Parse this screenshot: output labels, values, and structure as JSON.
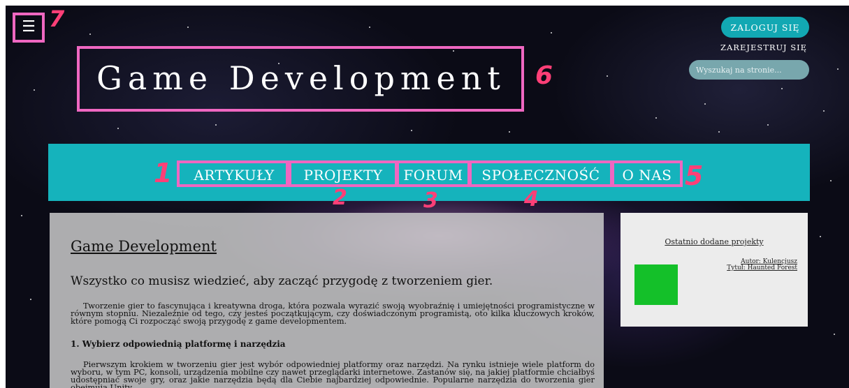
{
  "header": {
    "menu_icon": "hamburger-icon",
    "menu_glyph": "☰",
    "site_title": "Game Development",
    "login_label": "ZALOGUJ SIĘ",
    "register_label": "ZAREJESTRUJ SIĘ",
    "search_placeholder": "Wyszukaj na stronie..."
  },
  "nav": {
    "items": [
      {
        "label": "ARTYKUŁY"
      },
      {
        "label": "PROJEKTY"
      },
      {
        "label": "FORUM"
      },
      {
        "label": "SPOŁECZNOŚĆ"
      },
      {
        "label": "O NAS"
      }
    ]
  },
  "annotations": {
    "markers": [
      "1",
      "2",
      "3",
      "4",
      "5",
      "6",
      "7"
    ],
    "color": "#ef67c1"
  },
  "main": {
    "title": "Game Development",
    "subtitle": "Wszystko co musisz wiedzieć, aby zacząć przygodę z tworzeniem gier.",
    "intro": "Tworzenie gier to fascynująca i kreatywna droga, która pozwala wyrazić swoją wyobraźnię i umiejętności programistyczne w równym stopniu. Niezależnie od tego, czy jesteś początkującym, czy doświadczonym programistą, oto kilka kluczowych kroków, które pomogą Ci rozpocząć swoją przygodę z game developmentem.",
    "section1_heading": "1. Wybierz odpowiednią platformę i narzędzia",
    "section1_text": "Pierwszym krokiem w tworzeniu gier jest wybór odpowiedniej platformy oraz narzędzi. Na rynku istnieje wiele platform do wyboru, w tym PC, konsoli, urządzenia mobilne czy nawet przeglądarki internetowe. Zastanów się, na jakiej platformie chciałbyś udostępniać swoje gry, oraz jakie narzędzia będą dla Ciebie najbardziej odpowiednie. Popularne narzędzia do tworzenia gier obejmują Unity,"
  },
  "sidebar": {
    "title": "Ostatnio dodane projekty",
    "author": "Autor: Kulencjusz",
    "project_title": "Tytuł: Haunted Forest",
    "thumb_color": "#14c029"
  },
  "colors": {
    "teal": "#15b3bc",
    "login_bg": "#12a8b3",
    "highlight": "#ef67c1",
    "marker": "#ff3f77"
  }
}
